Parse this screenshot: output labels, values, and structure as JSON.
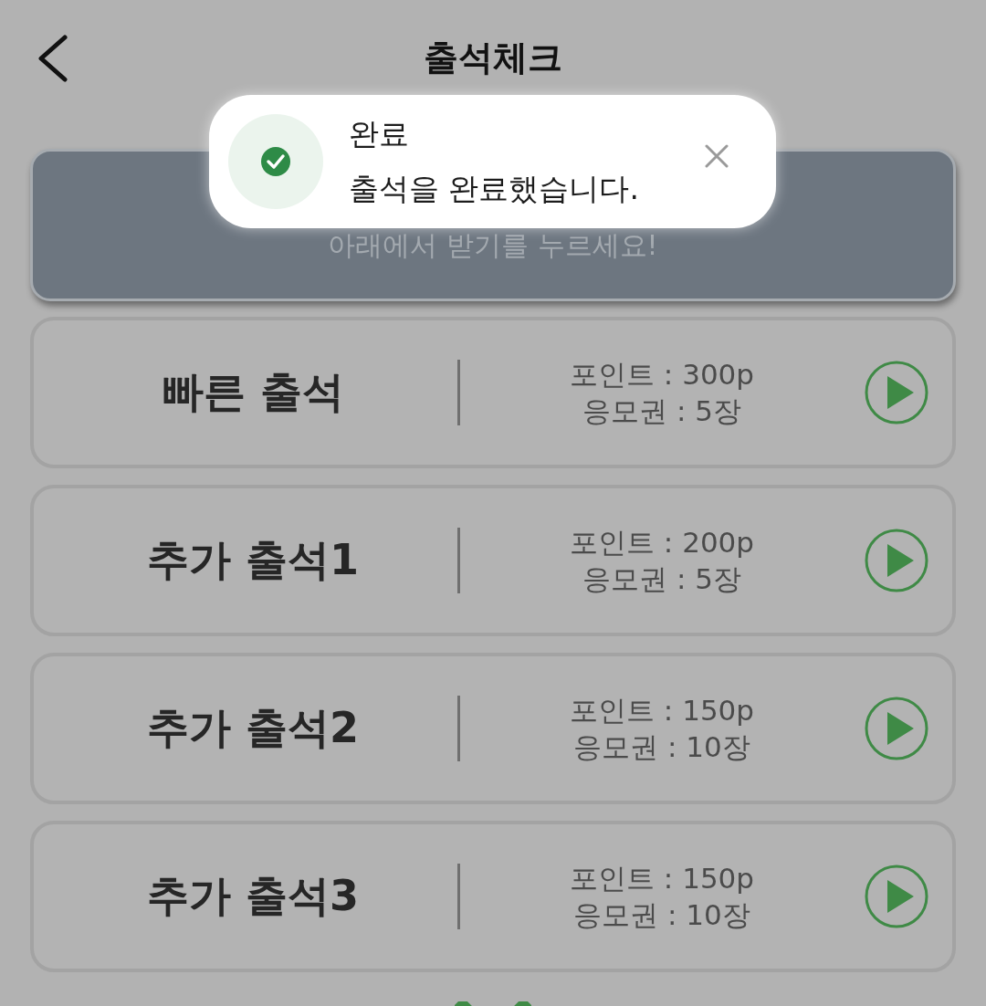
{
  "header": {
    "title": "출석체크"
  },
  "toast": {
    "title": "완료",
    "message": "출석을 완료했습니다."
  },
  "banner": {
    "text": "아래에서 받기를 누르세요!"
  },
  "rewards": [
    {
      "name": "빠른 출석",
      "points": "포인트 : 300p",
      "tickets": "응모권 : 5장"
    },
    {
      "name": "추가 출석1",
      "points": "포인트 : 200p",
      "tickets": "응모권 : 5장"
    },
    {
      "name": "추가 출석2",
      "points": "포인트 : 150p",
      "tickets": "응모권 : 10장"
    },
    {
      "name": "추가 출석3",
      "points": "포인트 : 150p",
      "tickets": "응모권 : 10장"
    }
  ]
}
